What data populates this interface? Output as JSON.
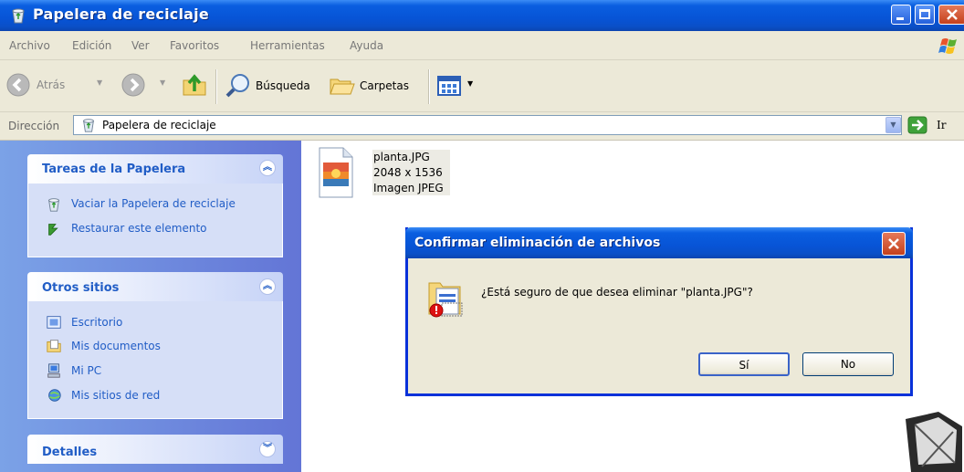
{
  "window": {
    "title": "Papelera de reciclaje"
  },
  "menu": [
    "Archivo",
    "Edición",
    "Ver",
    "Favoritos",
    "Herramientas",
    "Ayuda"
  ],
  "toolbar": {
    "back": "Atrás",
    "search": "Búsqueda",
    "folders": "Carpetas"
  },
  "address": {
    "label": "Dirección",
    "value": "Papelera de reciclaje",
    "go": "Ir"
  },
  "tasks_panel": {
    "title": "Tareas de la Papelera",
    "items": [
      "Vaciar la Papelera de reciclaje",
      "Restaurar este elemento"
    ]
  },
  "places_panel": {
    "title": "Otros sitios",
    "items": [
      "Escritorio",
      "Mis documentos",
      "Mi PC",
      "Mis sitios de red"
    ]
  },
  "details_panel": {
    "title": "Detalles"
  },
  "file": {
    "name": "planta.JPG",
    "dimensions": "2048 x 1536",
    "type": "Imagen JPEG"
  },
  "dialog": {
    "title": "Confirmar eliminación de archivos",
    "message": "¿Está seguro de que desea eliminar \"planta.JPG\"?",
    "yes": "Sí",
    "no": "No"
  }
}
